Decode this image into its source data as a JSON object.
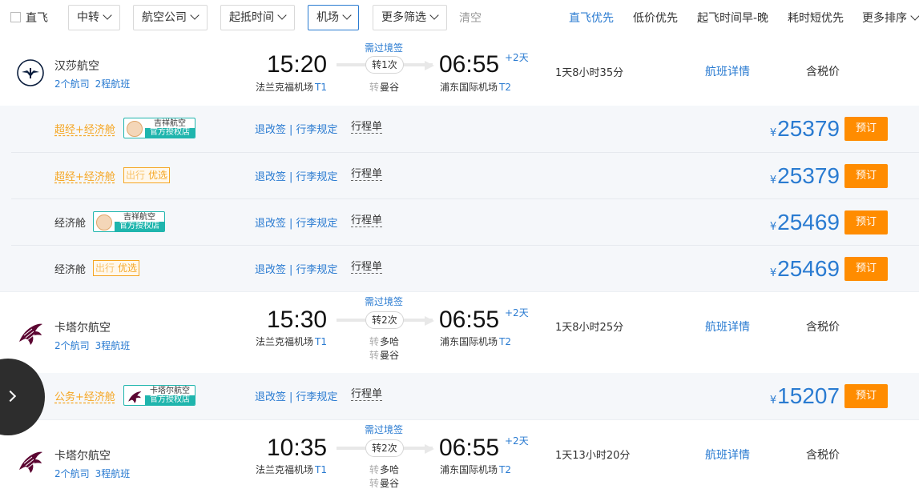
{
  "filters": {
    "direct_label": "直飞",
    "buttons": [
      "中转",
      "航空公司",
      "起抵时间",
      "机场",
      "更多筛选"
    ],
    "clear_label": "清空"
  },
  "sort": {
    "options": [
      "直飞优先",
      "低价优先",
      "起飞时间早-晚",
      "耗时短优先",
      "更多排序"
    ]
  },
  "flights": [
    {
      "airline": "汉莎航空",
      "carriers": "2个航司",
      "legs": "2程航班",
      "dep_time": "15:20",
      "arr_time": "06:55",
      "day_offset": "+2天",
      "dep_airport": "法兰克福机场",
      "dep_terminal": "T1",
      "arr_airport": "浦东国际机场",
      "arr_terminal": "T2",
      "transit_note": "需过境签",
      "stops": "转1次",
      "via": [
        {
          "mark": "转",
          "city": "曼谷"
        }
      ],
      "duration": "1天8小时35分",
      "details_label": "航班详情",
      "tax_note": "含税价",
      "fares": [
        {
          "cabin": "超经+经济舱",
          "badge": "store",
          "store_name": "吉祥航空",
          "store_auth": "官方授权店",
          "change_label": "退改签",
          "baggage_label": "行李规定",
          "itinerary_label": "行程单",
          "currency": "¥",
          "price": "25379",
          "book_label": "预订"
        },
        {
          "cabin": "超经+经济舱",
          "badge": "ct",
          "ct_a": "出行",
          "ct_b": "优选",
          "change_label": "退改签",
          "baggage_label": "行李规定",
          "itinerary_label": "行程单",
          "currency": "¥",
          "price": "25379",
          "book_label": "预订"
        },
        {
          "cabin": "经济舱",
          "badge": "store",
          "store_name": "吉祥航空",
          "store_auth": "官方授权店",
          "change_label": "退改签",
          "baggage_label": "行李规定",
          "itinerary_label": "行程单",
          "currency": "¥",
          "price": "25469",
          "book_label": "预订"
        },
        {
          "cabin": "经济舱",
          "badge": "ct",
          "ct_a": "出行",
          "ct_b": "优选",
          "change_label": "退改签",
          "baggage_label": "行李规定",
          "itinerary_label": "行程单",
          "currency": "¥",
          "price": "25469",
          "book_label": "预订"
        }
      ]
    },
    {
      "airline": "卡塔尔航空",
      "carriers": "2个航司",
      "legs": "3程航班",
      "dep_time": "15:30",
      "arr_time": "06:55",
      "day_offset": "+2天",
      "dep_airport": "法兰克福机场",
      "dep_terminal": "T1",
      "arr_airport": "浦东国际机场",
      "arr_terminal": "T2",
      "transit_note": "需过境签",
      "stops": "转2次",
      "via": [
        {
          "mark": "转",
          "city": "多哈"
        },
        {
          "mark": "转",
          "city": "曼谷"
        }
      ],
      "duration": "1天8小时25分",
      "details_label": "航班详情",
      "tax_note": "含税价",
      "fares": [
        {
          "cabin": "公务+经济舱",
          "badge": "store",
          "store_name": "卡塔尔航空",
          "store_auth": "官方授权店",
          "change_label": "退改签",
          "baggage_label": "行李规定",
          "itinerary_label": "行程单",
          "currency": "¥",
          "price": "15207",
          "book_label": "预订"
        }
      ]
    },
    {
      "airline": "卡塔尔航空",
      "carriers": "2个航司",
      "legs": "3程航班",
      "dep_time": "10:35",
      "arr_time": "06:55",
      "day_offset": "+2天",
      "dep_airport": "法兰克福机场",
      "dep_terminal": "T1",
      "arr_airport": "浦东国际机场",
      "arr_terminal": "T2",
      "transit_note": "需过境签",
      "stops": "转2次",
      "via": [
        {
          "mark": "转",
          "city": "多哈"
        },
        {
          "mark": "转",
          "city": "曼谷"
        }
      ],
      "duration": "1天13小时20分",
      "details_label": "航班详情",
      "tax_note": "含税价",
      "fares": []
    }
  ],
  "colors": {
    "accent": "#2a7bd1",
    "orange": "#ff8c00",
    "teal": "#1fb5ad",
    "tag_orange": "#f5a623"
  }
}
